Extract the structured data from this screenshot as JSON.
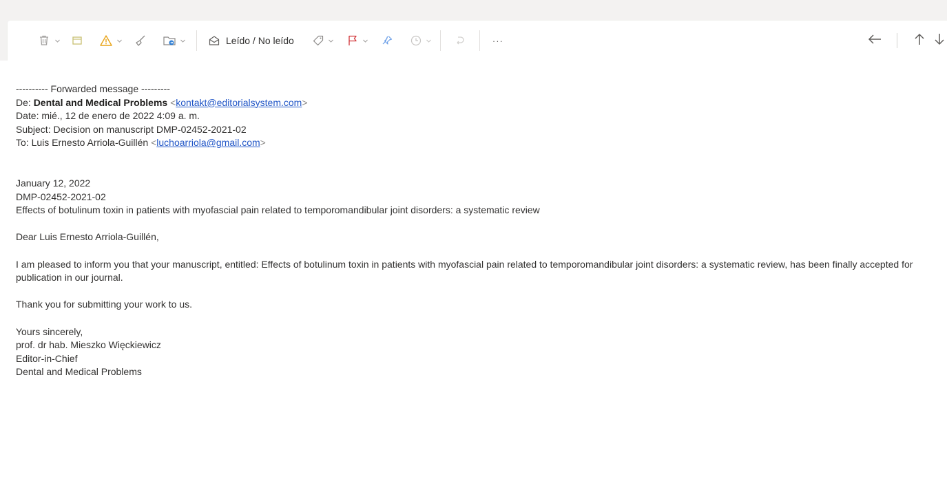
{
  "toolbar": {
    "icons": [
      "delete-icon",
      "archive-icon",
      "report-icon",
      "sweep-icon",
      "move-to-icon"
    ],
    "read_unread_label": "Leído / No leído",
    "right_icons": [
      "tag-icon",
      "flag-icon",
      "pin-icon",
      "snooze-icon",
      "undo-icon",
      "more-icon"
    ],
    "more_label": "···",
    "colors": {
      "delete": "#a19f9d",
      "archive": "#c8c074",
      "report": "#e8a316",
      "sweep": "#8a8886",
      "move": "#2b7cd3",
      "flag": "#d13438",
      "pin": "#6da0e8"
    }
  },
  "navigation": {
    "back_icon": "arrow-left-icon",
    "up_icon": "arrow-up-icon",
    "down_icon": "arrow-down-icon"
  },
  "email": {
    "forwarded_header": "---------- Forwarded message ---------",
    "from_prefix": "De: ",
    "from_name": "Dental and Medical Problems",
    "from_email": "kontakt@editorialsystem.com",
    "date_line": "Date: mié., 12 de enero de 2022 4:09 a. m.",
    "subject_line": "Subject: Decision on manuscript DMP-02452-2021-02",
    "to_prefix": "To: Luis Ernesto Arriola-Guillén ",
    "to_email": "luchoarriola@gmail.com",
    "letter_date": "January 12, 2022",
    "manuscript_id": "DMP-02452-2021-02",
    "manuscript_title": "Effects of botulinum toxin in patients with myofascial pain related to temporomandibular joint disorders: a systematic review",
    "salutation": "Dear Luis Ernesto Arriola-Guillén,",
    "acceptance_paragraph": "I am pleased to inform you that your manuscript, entitled: Effects of botulinum toxin in patients with myofascial pain related to temporomandibular joint disorders: a systematic review, has been finally accepted for publication in our journal.",
    "thanks_line": "Thank you for submitting your work to us.",
    "closing": "Yours sincerely,",
    "signer_name": "prof. dr hab. Mieszko Więckiewicz",
    "signer_title": "Editor-in-Chief",
    "signer_org": "Dental and Medical Problems"
  }
}
